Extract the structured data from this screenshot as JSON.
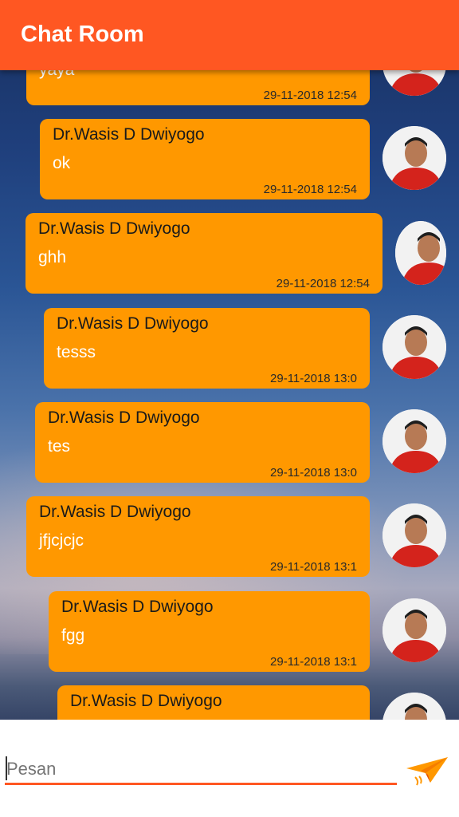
{
  "app": {
    "title": "Chat Room"
  },
  "messages": [
    {
      "name": "",
      "text": "yaya",
      "time": "29-11-2018 12:54"
    },
    {
      "name": "Dr.Wasis D Dwiyogo",
      "text": "ok",
      "time": "29-11-2018 12:54"
    },
    {
      "name": "Dr.Wasis D Dwiyogo",
      "text": "ghh",
      "time": "29-11-2018 12:54"
    },
    {
      "name": "Dr.Wasis D Dwiyogo",
      "text": "tesss",
      "time": "29-11-2018 13:0"
    },
    {
      "name": "Dr.Wasis D Dwiyogo",
      "text": "tes",
      "time": "29-11-2018 13:0"
    },
    {
      "name": "Dr.Wasis D Dwiyogo",
      "text": "jfjcjcjc",
      "time": "29-11-2018 13:1"
    },
    {
      "name": "Dr.Wasis D Dwiyogo",
      "text": "fgg",
      "time": "29-11-2018 13:1"
    },
    {
      "name": "Dr.Wasis D Dwiyogo",
      "text": "",
      "time": ""
    }
  ],
  "input": {
    "placeholder": "Pesan",
    "value": ""
  },
  "icons": {
    "send": "send-paper-plane-icon",
    "avatar": "user-avatar"
  },
  "colors": {
    "appbar": "#ff5722",
    "bubble": "#ff9800",
    "underline": "#ff5722",
    "send": "#ff9800"
  }
}
